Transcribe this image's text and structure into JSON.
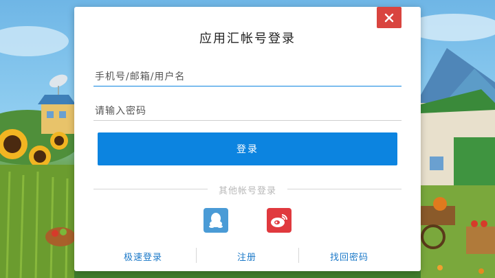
{
  "dialog": {
    "title": "应用汇帐号登录",
    "close_icon": "close-icon",
    "phone_field": {
      "value": "",
      "placeholder": "手机号/邮箱/用户名"
    },
    "password_field": {
      "value": "",
      "placeholder": "请输入密码"
    },
    "login_label": "登录",
    "other_login_label": "其他帐号登录",
    "social": [
      {
        "name": "qq-icon",
        "color": "#4a9bd6"
      },
      {
        "name": "weibo-icon",
        "color": "#e0393e"
      }
    ],
    "links": {
      "quick_login": "极速登录",
      "register": "注册",
      "recover": "找回密码"
    }
  },
  "colors": {
    "accent": "#0c84e0",
    "close": "#d9443f",
    "focus_line": "#0c84e0",
    "link": "#1a78c8"
  }
}
